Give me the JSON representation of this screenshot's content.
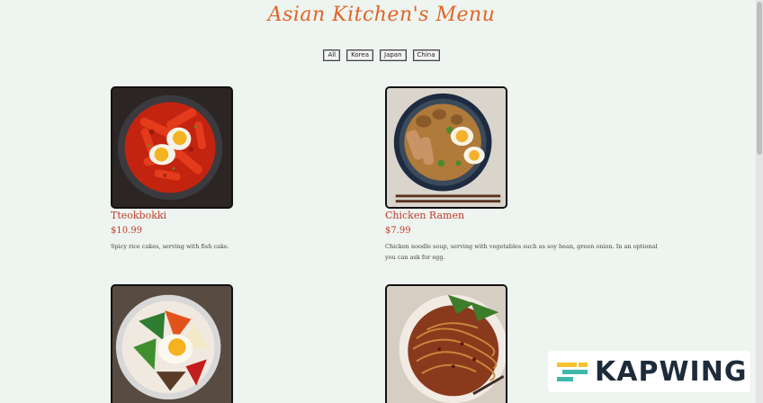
{
  "header": {
    "title": "Asian Kitchen's Menu"
  },
  "filters": [
    "All",
    "Korea",
    "Japan",
    "China"
  ],
  "menu": {
    "items": [
      {
        "name": "Tteokbokki",
        "price": "$10.99",
        "description": "Spicy rice cakes, serving with fish cake."
      },
      {
        "name": "Chicken Ramen",
        "price": "$7.99",
        "description": "Chicken noodle soup, serving with vegetables such as soy bean, green onion. In an optional you can ask for egg."
      },
      {
        "name": "",
        "price": "",
        "description": ""
      },
      {
        "name": "",
        "price": "",
        "description": ""
      }
    ]
  },
  "watermark": {
    "text": "KAPWING"
  },
  "colors": {
    "background": "#eef4ef",
    "title": "#e0652a",
    "item_text": "#c0392b"
  }
}
